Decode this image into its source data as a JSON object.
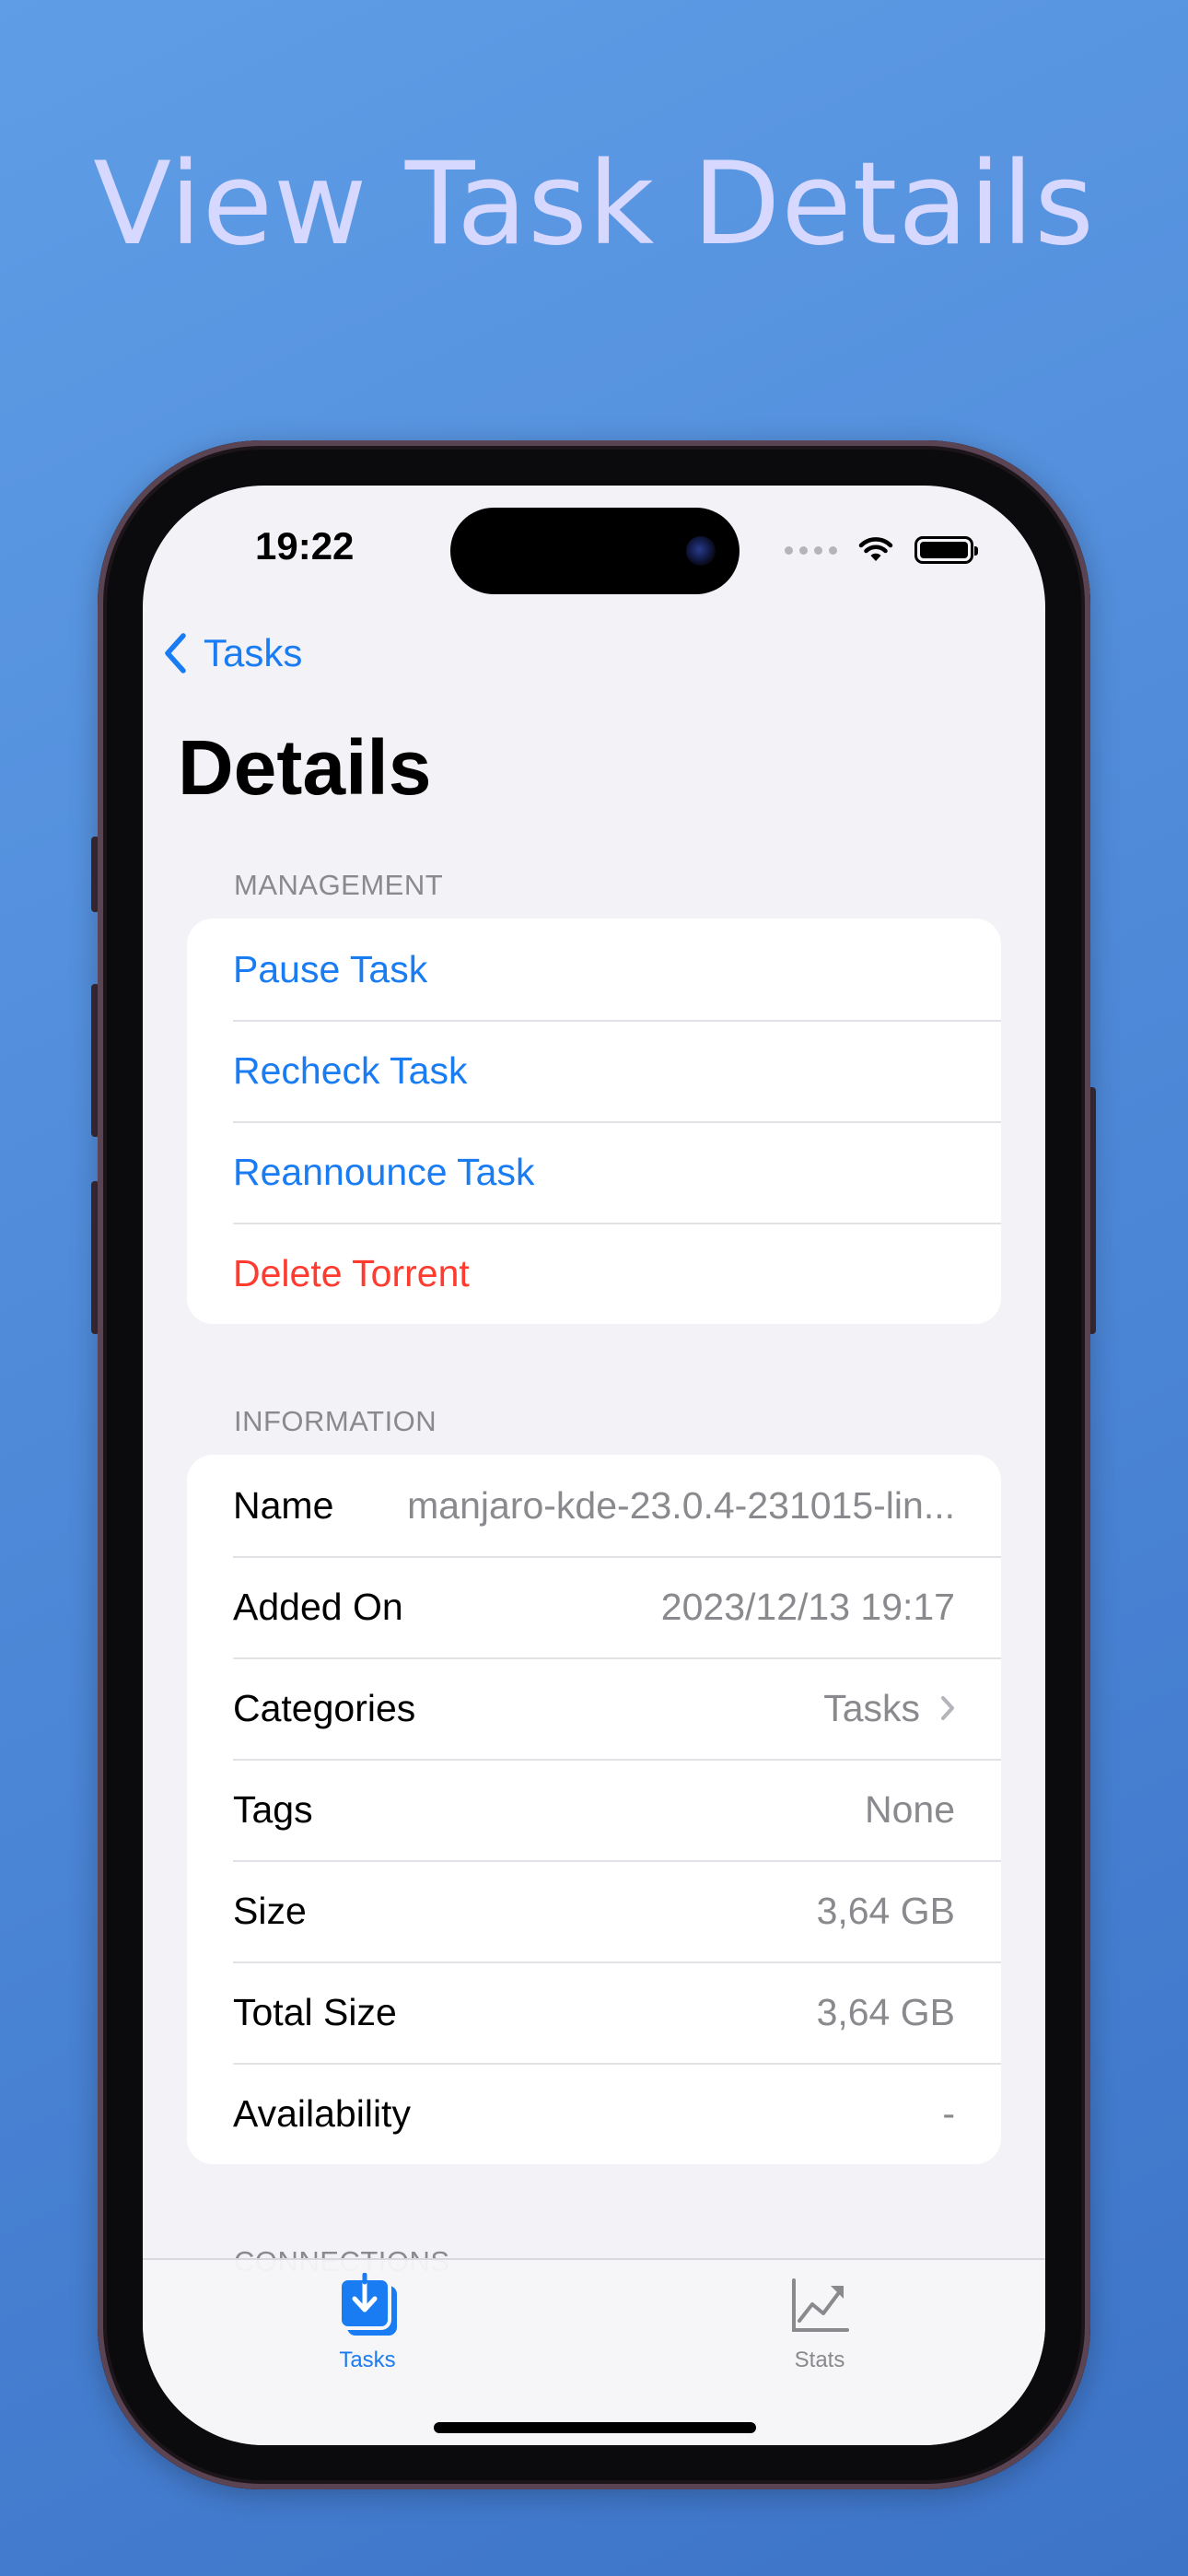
{
  "headline": "View Task Details",
  "status_bar": {
    "time": "19:22"
  },
  "nav": {
    "back_label": "Tasks",
    "title": "Details"
  },
  "management": {
    "header": "MANAGEMENT",
    "actions": [
      {
        "label": "Pause Task"
      },
      {
        "label": "Recheck Task"
      },
      {
        "label": "Reannounce Task"
      },
      {
        "label": "Delete Torrent"
      }
    ]
  },
  "information": {
    "header": "INFORMATION",
    "rows": [
      {
        "label": "Name",
        "value": "manjaro-kde-23.0.4-231015-lin..."
      },
      {
        "label": "Added On",
        "value": "2023/12/13 19:17"
      },
      {
        "label": "Categories",
        "value": "Tasks"
      },
      {
        "label": "Tags",
        "value": "None"
      },
      {
        "label": "Size",
        "value": "3,64 GB"
      },
      {
        "label": "Total Size",
        "value": "3,64 GB"
      },
      {
        "label": "Availability",
        "value": "-"
      }
    ]
  },
  "next_section_header": "CONNECTIONS",
  "tab_bar": {
    "tabs": [
      {
        "label": "Tasks",
        "icon": "tasks-download-icon",
        "selected": true
      },
      {
        "label": "Stats",
        "icon": "stats-chart-icon",
        "selected": false
      }
    ]
  },
  "colors": {
    "accent": "#1a7cf2",
    "destructive": "#ff3b30",
    "secondary_text": "#8a8a8e",
    "background_gradient_start": "#5f9de6",
    "background_gradient_end": "#3d74c8",
    "headline": "#d6d8ff"
  }
}
